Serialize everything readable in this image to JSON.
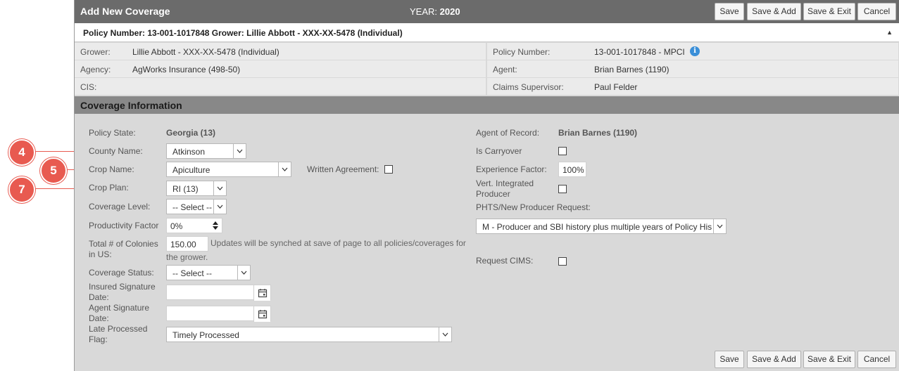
{
  "header": {
    "title": "Add New Coverage",
    "year_label": "YEAR:",
    "year_value": "2020",
    "buttons": {
      "save": "Save",
      "save_add": "Save & Add",
      "save_exit": "Save & Exit",
      "cancel": "Cancel"
    }
  },
  "policy_bar": {
    "text": "Policy Number: 13-001-1017848 Grower: Lillie Abbott - XXX-XX-5478 (Individual)",
    "collapse_glyph": "▲"
  },
  "info": {
    "grower_label": "Grower:",
    "grower_value": "Lillie Abbott - XXX-XX-5478 (Individual)",
    "policy_number_label": "Policy Number:",
    "policy_number_value": "13-001-1017848 - MPCI",
    "agency_label": "Agency:",
    "agency_value": "AgWorks Insurance (498-50)",
    "agent_label": "Agent:",
    "agent_value": "Brian Barnes (1190)",
    "cis_label": "CIS:",
    "claims_supervisor_label": "Claims Supervisor:",
    "claims_supervisor_value": "Paul Felder"
  },
  "coverage": {
    "section_title": "Coverage Information",
    "policy_state_label": "Policy State:",
    "policy_state_value": "Georgia (13)",
    "county_name_label": "County Name:",
    "county_name_value": "Atkinson",
    "crop_name_label": "Crop Name:",
    "crop_name_value": "Apiculture",
    "written_agreement_label": "Written Agreement:",
    "crop_plan_label": "Crop Plan:",
    "crop_plan_value": "RI (13)",
    "coverage_level_label": "Coverage Level:",
    "coverage_level_value": "-- Select --",
    "productivity_factor_label": "Productivity Factor",
    "productivity_factor_value": "0%",
    "total_colonies_label_1": "Total # of Colonies",
    "total_colonies_label_2": "in US:",
    "total_colonies_value": "150.00",
    "sync_note_1": "Updates will be synched at save of page to all policies/coverages for",
    "sync_note_2": "the grower.",
    "coverage_status_label": "Coverage Status:",
    "coverage_status_value": "-- Select --",
    "insured_sig_label_1": "Insured Signature",
    "insured_sig_label_2": "Date:",
    "agent_sig_label_1": "Agent Signature",
    "agent_sig_label_2": "Date:",
    "late_processed_label_1": "Late Processed",
    "late_processed_label_2": "Flag:",
    "late_processed_value": "Timely Processed",
    "agent_of_record_label": "Agent of Record:",
    "agent_of_record_value": "Brian Barnes (1190)",
    "is_carryover_label": "Is Carryover",
    "experience_factor_label": "Experience Factor:",
    "experience_factor_value": "100%",
    "vert_integrated_label_1": "Vert. Integrated",
    "vert_integrated_label_2": "Producer",
    "phts_label": "PHTS/New Producer Request:",
    "phts_value": "M - Producer and SBI history plus multiple years of Policy His",
    "request_cims_label": "Request CIMS:"
  },
  "callouts": [
    "4",
    "5",
    "7"
  ],
  "colors": {
    "title_bar": "#6b6b6b",
    "section_bar": "#888888",
    "panel": "#d9d9d9",
    "callout": "#e85a50",
    "info_icon": "#3a8fd8"
  }
}
